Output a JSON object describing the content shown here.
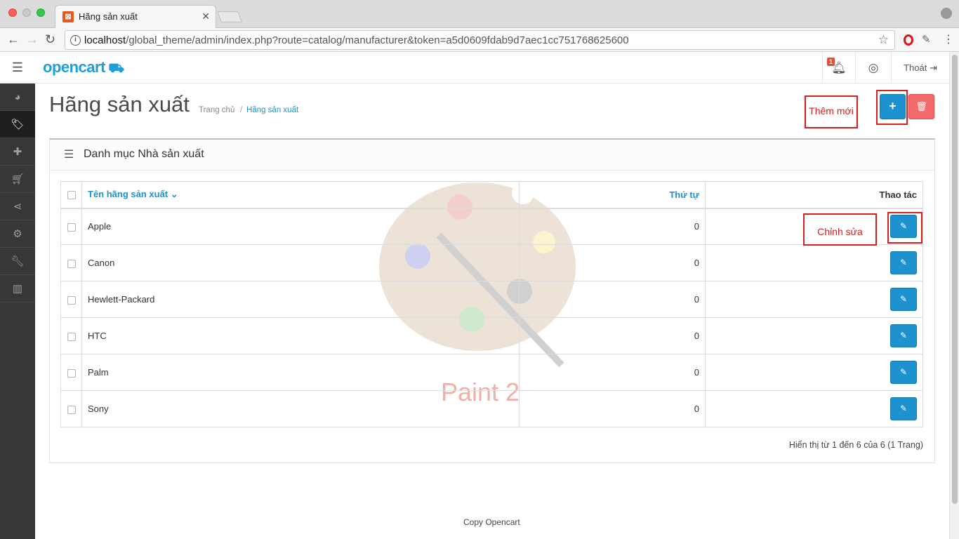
{
  "browser": {
    "tab_title": "Hãng sản xuất",
    "url_host": "localhost",
    "url_path": "/global_theme/admin/index.php?route=catalog/manufacturer&token=a5d0609fdab9d7aec1cc751768625600"
  },
  "header": {
    "logo_text": "opencart",
    "notification_count": "1",
    "logout_label": "Thoát"
  },
  "page": {
    "title": "Hãng sản xuất",
    "breadcrumb": {
      "home": "Trang chủ",
      "separator": "/",
      "current": "Hãng sản xuất"
    },
    "add_tooltip_note": "Thêm mới",
    "edit_tooltip_note": "Chỉnh sửa"
  },
  "panel": {
    "title": "Danh mục Nhà sản xuất",
    "columns": {
      "name": "Tên hãng sản xuất",
      "sort_order": "Thứ tự",
      "action": "Thao tác"
    },
    "rows": [
      {
        "name": "Apple",
        "sort_order": "0"
      },
      {
        "name": "Canon",
        "sort_order": "0"
      },
      {
        "name": "Hewlett-Packard",
        "sort_order": "0"
      },
      {
        "name": "HTC",
        "sort_order": "0"
      },
      {
        "name": "Palm",
        "sort_order": "0"
      },
      {
        "name": "Sony",
        "sort_order": "0"
      }
    ],
    "pagination_text": "Hiển thị từ 1 đến 6 của 6 (1 Trang)"
  },
  "watermark": {
    "text": "Paint 2"
  },
  "footer": {
    "text": "Copy Opencart"
  },
  "colors": {
    "primary": "#1e91cf",
    "danger": "#f56b6b",
    "sidebar": "#373737",
    "annotation": "#d71f1f"
  },
  "icons": {
    "sidebar": [
      "dashboard-icon",
      "tags-icon",
      "puzzle-icon",
      "cart-icon",
      "share-icon",
      "cog-icon",
      "wrench-icon",
      "bar-chart-icon"
    ]
  }
}
